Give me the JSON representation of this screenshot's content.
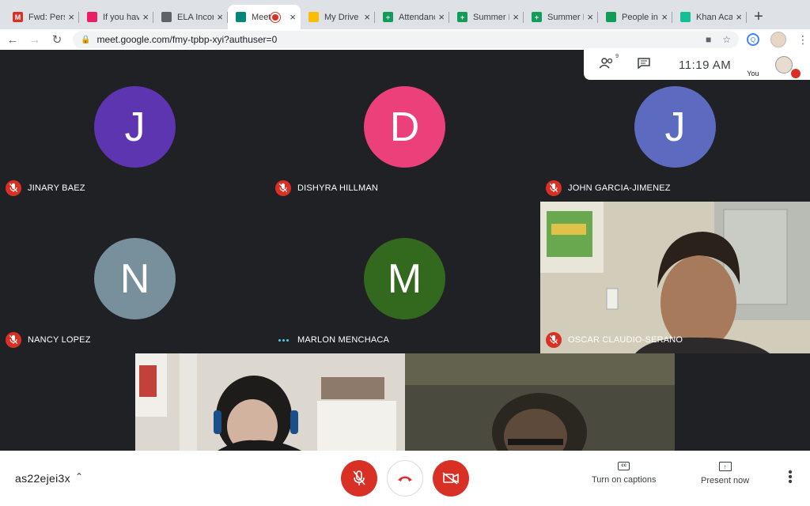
{
  "browser": {
    "tabs": [
      {
        "title": "Fwd: Pers",
        "favicon": "gmail-icon",
        "color": "#d93025",
        "glyph": "M"
      },
      {
        "title": "If you hav",
        "favicon": "doc-pink-icon",
        "color": "#e91e63",
        "glyph": ""
      },
      {
        "title": "ELA Incor",
        "favicon": "classroom-icon",
        "color": "#5f6368",
        "glyph": ""
      },
      {
        "title": "Meet",
        "favicon": "meet-icon",
        "color": "#00897b",
        "glyph": "",
        "active": true,
        "recording": true
      },
      {
        "title": "My Drive",
        "favicon": "drive-icon",
        "color": "#fbbc04",
        "glyph": ""
      },
      {
        "title": "Attendanc",
        "favicon": "sheets-icon",
        "color": "#0f9d58",
        "glyph": "+"
      },
      {
        "title": "Summer I",
        "favicon": "sheets-icon",
        "color": "#0f9d58",
        "glyph": "+"
      },
      {
        "title": "Summer I",
        "favicon": "sheets-icon",
        "color": "#0f9d58",
        "glyph": "+"
      },
      {
        "title": "People in",
        "favicon": "classroom-icon",
        "color": "#0f9d58",
        "glyph": ""
      },
      {
        "title": "Khan Aca",
        "favicon": "khan-icon",
        "color": "#14bf96",
        "glyph": ""
      }
    ],
    "url": "meet.google.com/fmy-tpbp-xyi?authuser=0"
  },
  "meeting_info": {
    "participant_count": "9",
    "time": "11:19 AM",
    "self_label": "You"
  },
  "participants": [
    {
      "name": "JINARY BAEZ",
      "initial": "J",
      "avatar_color": "#5e35b1",
      "muted": true
    },
    {
      "name": "DISHYRA HILLMAN",
      "initial": "D",
      "avatar_color": "#ec407a",
      "muted": true
    },
    {
      "name": "JOHN GARCIA-JIMENEZ",
      "initial": "J",
      "avatar_color": "#5c6bc0",
      "muted": true
    },
    {
      "name": "NANCY LOPEZ",
      "initial": "N",
      "avatar_color": "#78909c",
      "muted": true
    },
    {
      "name": "MARLON MENCHACA",
      "initial": "M",
      "avatar_color": "#33691e",
      "muted": false,
      "speaking": true
    },
    {
      "name": "OSCAR CLAUDIO-SERANO",
      "initial": "",
      "avatar_color": "",
      "muted": true,
      "video": true
    }
  ],
  "controls": {
    "meeting_code": "as22ejei3x",
    "captions_label": "Turn on captions",
    "present_label": "Present now"
  }
}
